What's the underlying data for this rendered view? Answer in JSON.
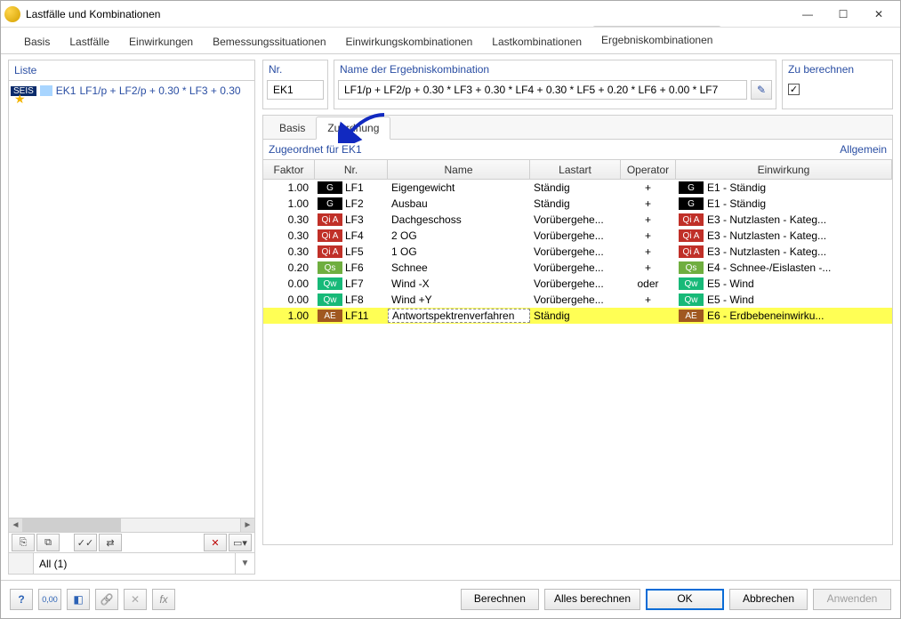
{
  "window": {
    "title": "Lastfälle und Kombinationen",
    "minimize": "—",
    "maximize": "☐",
    "close": "✕"
  },
  "tabs": {
    "items": [
      "Basis",
      "Lastfälle",
      "Einwirkungen",
      "Bemessungssituationen",
      "Einwirkungskombinationen",
      "Lastkombinationen",
      "Ergebniskombinationen"
    ],
    "active_index": 6
  },
  "liste": {
    "title": "Liste",
    "rows": [
      {
        "badge": "SEIS",
        "code": "EK1",
        "text": "LF1/p + LF2/p + 0.30 * LF3 + 0.30"
      }
    ],
    "filter": "All (1)",
    "toolbar": {
      "new": "＋",
      "copy": "⧉",
      "check": "✓✓",
      "toggle": "⇄",
      "delete": "✕",
      "columns": "▭▾"
    }
  },
  "nr": {
    "title": "Nr.",
    "value": "EK1"
  },
  "name": {
    "title": "Name der Ergebniskombination",
    "value": "LF1/p + LF2/p + 0.30 * LF3 + 0.30 * LF4 + 0.30 * LF5 + 0.20 * LF6 + 0.00 * LF7",
    "edit_icon": "✎"
  },
  "calc": {
    "title": "Zu berechnen",
    "checked": "✓"
  },
  "subtabs": {
    "items": [
      "Basis",
      "Zuordnung"
    ],
    "active_index": 1
  },
  "assign": {
    "heading": "Zugeordnet für EK1",
    "right_link": "Allgemein",
    "cols": {
      "faktor": "Faktor",
      "nr": "Nr.",
      "name": "Name",
      "lastart": "Lastart",
      "operator": "Operator",
      "einwirkung": "Einwirkung"
    },
    "rows": [
      {
        "faktor": "1.00",
        "tag": "G",
        "lf": "LF1",
        "name": "Eigengewicht",
        "lastart": "Ständig",
        "op": "+",
        "etag": "G",
        "einw": "E1 - Ständig"
      },
      {
        "faktor": "1.00",
        "tag": "G",
        "lf": "LF2",
        "name": "Ausbau",
        "lastart": "Ständig",
        "op": "+",
        "etag": "G",
        "einw": "E1 - Ständig"
      },
      {
        "faktor": "0.30",
        "tag": "QiA",
        "lf": "LF3",
        "name": "Dachgeschoss",
        "lastart": "Vorübergehe...",
        "op": "+",
        "etag": "QiA",
        "einw": "E3 - Nutzlasten - Kateg..."
      },
      {
        "faktor": "0.30",
        "tag": "QiA",
        "lf": "LF4",
        "name": "2 OG",
        "lastart": "Vorübergehe...",
        "op": "+",
        "etag": "QiA",
        "einw": "E3 - Nutzlasten - Kateg..."
      },
      {
        "faktor": "0.30",
        "tag": "QiA",
        "lf": "LF5",
        "name": "1 OG",
        "lastart": "Vorübergehe...",
        "op": "+",
        "etag": "QiA",
        "einw": "E3 - Nutzlasten - Kateg..."
      },
      {
        "faktor": "0.20",
        "tag": "Qs",
        "lf": "LF6",
        "name": "Schnee",
        "lastart": "Vorübergehe...",
        "op": "+",
        "etag": "Qs",
        "einw": "E4 - Schnee-/Eislasten -..."
      },
      {
        "faktor": "0.00",
        "tag": "Qw",
        "lf": "LF7",
        "name": "Wind -X",
        "lastart": "Vorübergehe...",
        "op": "oder",
        "etag": "Qw",
        "einw": "E5 - Wind"
      },
      {
        "faktor": "0.00",
        "tag": "Qw",
        "lf": "LF8",
        "name": "Wind +Y",
        "lastart": "Vorübergehe...",
        "op": "+",
        "etag": "Qw",
        "einw": "E5 - Wind"
      },
      {
        "faktor": "1.00",
        "tag": "AE",
        "lf": "LF11",
        "name": "Antwortspektrenverfahren",
        "lastart": "Ständig",
        "op": "",
        "etag": "AE",
        "einw": "E6 - Erdbebeneinwirku...",
        "highlight": true
      }
    ]
  },
  "tags_label": {
    "G": "G",
    "QiA": "Qi A",
    "Qs": "Qs",
    "Qw": "Qw",
    "AE": "AE"
  },
  "footer": {
    "tools": {
      "help": "?",
      "t1": "0,00",
      "t2": "◧",
      "t3": "🔗",
      "t4": "✕",
      "t5": "fx"
    },
    "btn_calc": "Berechnen",
    "btn_calc_all": "Alles berechnen",
    "btn_ok": "OK",
    "btn_cancel": "Abbrechen",
    "btn_apply": "Anwenden"
  }
}
